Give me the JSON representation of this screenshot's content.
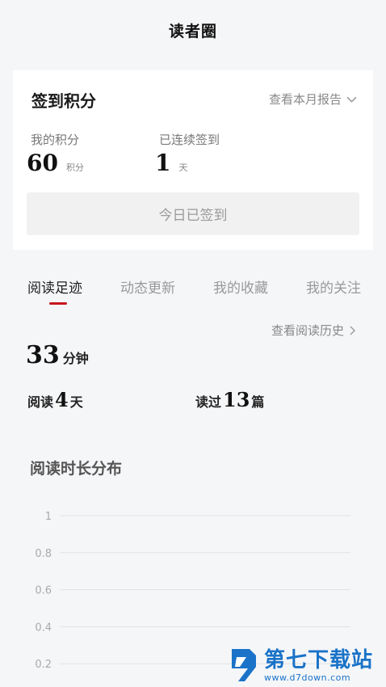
{
  "header": {
    "title": "读者圈"
  },
  "checkin": {
    "title": "签到积分",
    "report_link": "查看本月报告",
    "points_label": "我的积分",
    "points_value": "60",
    "points_unit": "积分",
    "streak_label": "已连续签到",
    "streak_value": "1",
    "streak_unit": "天",
    "button_label": "今日已签到"
  },
  "tabs": [
    {
      "label": "阅读足迹",
      "active": true
    },
    {
      "label": "动态更新",
      "active": false
    },
    {
      "label": "我的收藏",
      "active": false
    },
    {
      "label": "我的关注",
      "active": false
    }
  ],
  "reading": {
    "history_link": "查看阅读历史",
    "total_time_value": "33",
    "total_time_unit": "分钟",
    "days_label": "阅读",
    "days_value": "4",
    "days_unit": "天",
    "books_label": "读过",
    "books_value": "13",
    "books_unit": "篇"
  },
  "chart_data": {
    "type": "line",
    "title": "阅读时长分布",
    "yticks": [
      "1",
      "0.8",
      "0.6",
      "0.4",
      "0.2"
    ],
    "ylim": [
      0,
      1
    ],
    "grid": true,
    "series": []
  },
  "watermark": {
    "name": "第七下载站",
    "url": "www.d7down.com"
  },
  "colors": {
    "accent": "#c8161e",
    "watermark": "#1a73c8"
  }
}
